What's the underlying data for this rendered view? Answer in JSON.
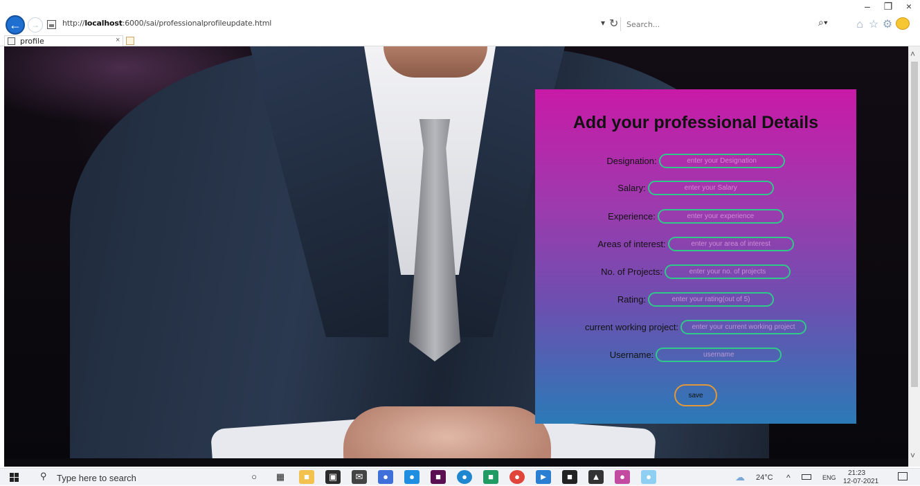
{
  "browser": {
    "url_prefix": "http://",
    "url_host": "localhost",
    "url_rest": ":6000/sai/professionalprofileupdate.html",
    "search_placeholder": "Search...",
    "tab_title": "profile",
    "tab_close": "×",
    "dropdown_arrow": "▾",
    "refresh": "↻",
    "search_go": "⌕▾",
    "win_minimize": "–",
    "win_maximize": "❐",
    "win_close": "×"
  },
  "form": {
    "title": "Add your professional Details",
    "fields": [
      {
        "label": "Designation:",
        "placeholder": "enter your Designation"
      },
      {
        "label": "Salary:",
        "placeholder": "enter your Salary"
      },
      {
        "label": "Experience:",
        "placeholder": "enter your experience"
      },
      {
        "label": "Areas of interest:",
        "placeholder": "enter your area of interest"
      },
      {
        "label": "No. of Projects:",
        "placeholder": "enter your no. of projects"
      },
      {
        "label": "Rating:",
        "placeholder": "enter your rating(out of 5)"
      },
      {
        "label": "current working project:",
        "placeholder": "enter your current working project"
      },
      {
        "label": "Username:",
        "placeholder": "username"
      }
    ],
    "save_label": "save"
  },
  "taskbar": {
    "search_text": "Type here to search",
    "temperature": "24°C",
    "language": "ENG",
    "time": "21:23",
    "date": "12-07-2021",
    "tray_chevron": "^"
  },
  "colors": {
    "panel_top": "#c81aa7",
    "panel_bottom": "#2b7ab6",
    "input_border": "#2fc98a",
    "button_border": "#e1973a"
  },
  "icons": [
    "back-icon",
    "forward-icon",
    "page-icon",
    "refresh-icon",
    "search-icon",
    "home-icon",
    "star-icon",
    "gear-icon",
    "smiley-icon",
    "windows-icon",
    "weather-icon",
    "battery-icon",
    "notification-icon"
  ]
}
